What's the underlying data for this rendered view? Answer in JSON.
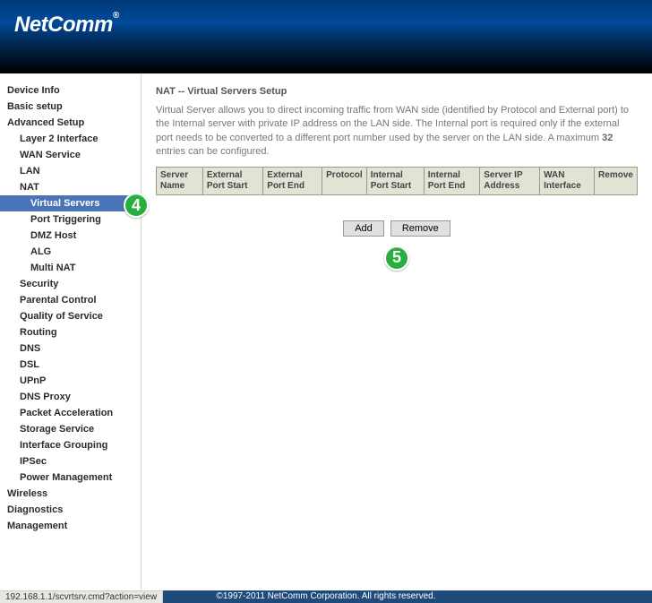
{
  "brand": "NetComm",
  "sidebar": {
    "items": [
      {
        "label": "Device Info",
        "level": 0
      },
      {
        "label": "Basic setup",
        "level": 0
      },
      {
        "label": "Advanced Setup",
        "level": 0
      },
      {
        "label": "Layer 2 Interface",
        "level": 1
      },
      {
        "label": "WAN Service",
        "level": 1
      },
      {
        "label": "LAN",
        "level": 1
      },
      {
        "label": "NAT",
        "level": 1
      },
      {
        "label": "Virtual Servers",
        "level": 2,
        "active": true
      },
      {
        "label": "Port Triggering",
        "level": 2
      },
      {
        "label": "DMZ Host",
        "level": 2
      },
      {
        "label": "ALG",
        "level": 2
      },
      {
        "label": "Multi NAT",
        "level": 2
      },
      {
        "label": "Security",
        "level": 1
      },
      {
        "label": "Parental Control",
        "level": 1
      },
      {
        "label": "Quality of Service",
        "level": 1
      },
      {
        "label": "Routing",
        "level": 1
      },
      {
        "label": "DNS",
        "level": 1
      },
      {
        "label": "DSL",
        "level": 1
      },
      {
        "label": "UPnP",
        "level": 1
      },
      {
        "label": "DNS Proxy",
        "level": 1
      },
      {
        "label": "Packet Acceleration",
        "level": 1
      },
      {
        "label": "Storage Service",
        "level": 1
      },
      {
        "label": "Interface Grouping",
        "level": 1
      },
      {
        "label": "IPSec",
        "level": 1
      },
      {
        "label": "Power Management",
        "level": 1
      },
      {
        "label": "Wireless",
        "level": 0
      },
      {
        "label": "Diagnostics",
        "level": 0
      },
      {
        "label": "Management",
        "level": 0
      }
    ]
  },
  "callouts": {
    "badge4": "4",
    "badge5": "5"
  },
  "page": {
    "title": "NAT -- Virtual Servers Setup",
    "desc_pre": "Virtual Server allows you to direct incoming traffic from WAN side (identified by Protocol and External port) to the Internal server with private IP address on the LAN side. The Internal port is required only if the external port needs to be converted to a different port number used by the server on the LAN side. A maximum ",
    "desc_bold": "32",
    "desc_post": " entries can be configured.",
    "columns": [
      "Server Name",
      "External Port Start",
      "External Port End",
      "Protocol",
      "Internal Port Start",
      "Internal Port End",
      "Server IP Address",
      "WAN Interface",
      "Remove"
    ],
    "buttons": {
      "add": "Add",
      "remove": "Remove"
    }
  },
  "footer": "©1997-2011 NetComm Corporation. All rights reserved.",
  "status_url": "192.168.1.1/scvrtsrv.cmd?action=view"
}
